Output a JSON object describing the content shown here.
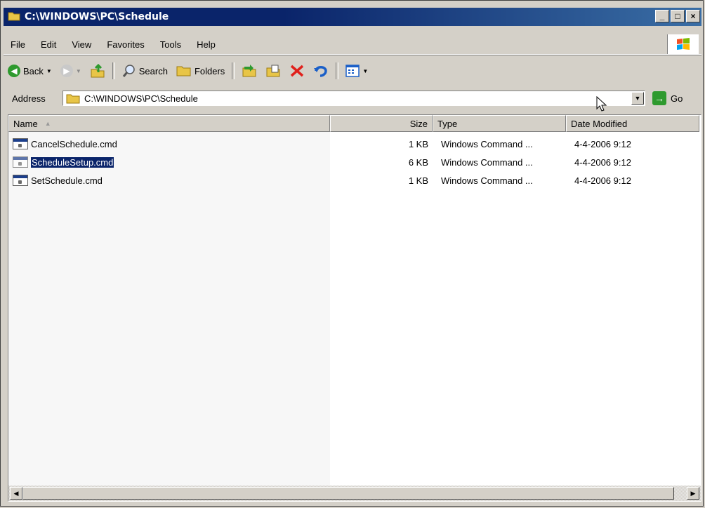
{
  "window": {
    "title": "C:\\WINDOWS\\PC\\Schedule",
    "buttons": {
      "minimize": "_",
      "maximize": "□",
      "close": "×"
    }
  },
  "menu": [
    "File",
    "Edit",
    "View",
    "Favorites",
    "Tools",
    "Help"
  ],
  "toolbar": {
    "back": "Back",
    "search": "Search",
    "folders": "Folders"
  },
  "address": {
    "label": "Address",
    "value": "C:\\WINDOWS\\PC\\Schedule",
    "go": "Go"
  },
  "columns": [
    "Name",
    "Size",
    "Type",
    "Date Modified"
  ],
  "files": [
    {
      "name": "CancelSchedule.cmd",
      "size": "1 KB",
      "type": "Windows Command ...",
      "date": "4-4-2006 9:12",
      "selected": false
    },
    {
      "name": "ScheduleSetup.cmd",
      "size": "6 KB",
      "type": "Windows Command ...",
      "date": "4-4-2006 9:12",
      "selected": true
    },
    {
      "name": "SetSchedule.cmd",
      "size": "1 KB",
      "type": "Windows Command ...",
      "date": "4-4-2006 9:12",
      "selected": false
    }
  ],
  "colors": {
    "titlebar": "#0a246a",
    "selection": "#0a246a"
  },
  "icons": [
    "folder-icon",
    "windows-logo-icon",
    "back-icon",
    "forward-icon",
    "up-folder-icon",
    "search-icon",
    "folders-icon",
    "move-to-icon",
    "copy-to-icon",
    "delete-icon",
    "undo-icon",
    "views-icon",
    "go-icon",
    "cmd-file-icon"
  ]
}
